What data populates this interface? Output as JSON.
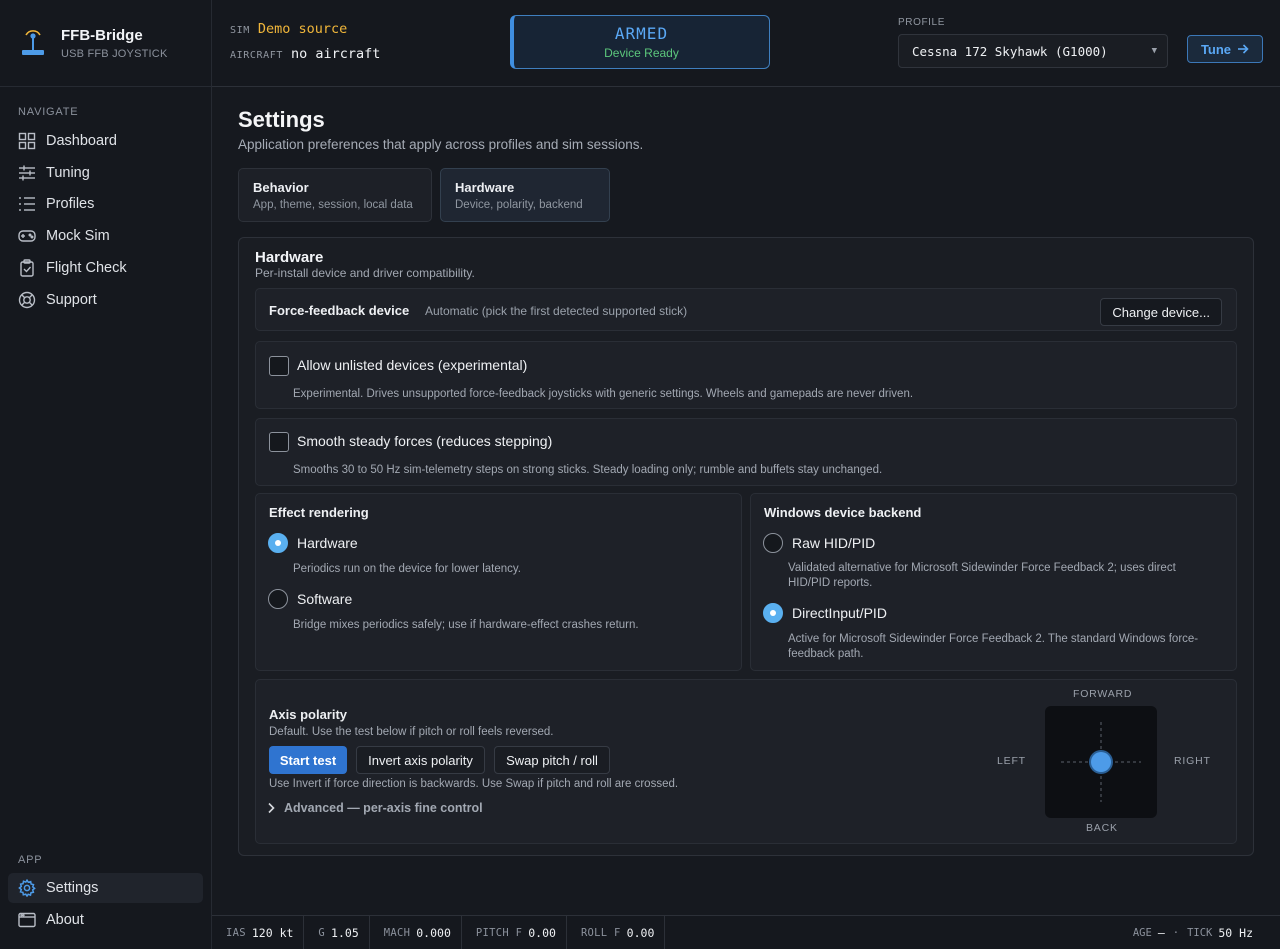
{
  "brand": {
    "name": "FFB-Bridge",
    "subtitle": "USB FFB JOYSTICK"
  },
  "sidebar": {
    "nav_heading": "NAVIGATE",
    "nav_items": [
      {
        "label": "Dashboard",
        "icon": "dashboard-icon"
      },
      {
        "label": "Tuning",
        "icon": "sliders-icon"
      },
      {
        "label": "Profiles",
        "icon": "list-icon"
      },
      {
        "label": "Mock Sim",
        "icon": "gamepad-icon"
      },
      {
        "label": "Flight Check",
        "icon": "clipboard-check-icon"
      },
      {
        "label": "Support",
        "icon": "lifebuoy-icon"
      }
    ],
    "app_heading": "APP",
    "app_items": [
      {
        "label": "Settings",
        "icon": "gear-icon",
        "active": true
      },
      {
        "label": "About",
        "icon": "window-icon",
        "active": false
      }
    ]
  },
  "topbar": {
    "sim_label": "SIM",
    "sim_value": "Demo source",
    "aircraft_label": "AIRCRAFT",
    "aircraft_value": "no aircraft",
    "status_title": "ARMED",
    "status_sub": "Device Ready",
    "profile_label": "PROFILE",
    "profile_value": "Cessna 172 Skyhawk (G1000)",
    "tune_label": "Tune"
  },
  "main": {
    "title": "Settings",
    "subtitle": "Application preferences that apply across profiles and sim sessions.",
    "tabs": [
      {
        "title": "Behavior",
        "desc": "App, theme, session, local data",
        "active": false
      },
      {
        "title": "Hardware",
        "desc": "Device, polarity, backend",
        "active": true
      }
    ],
    "hardware": {
      "title": "Hardware",
      "subtitle": "Per-install device and driver compatibility.",
      "device_label": "Force-feedback device",
      "device_value": "Automatic (pick the first detected supported stick)",
      "change_device": "Change device...",
      "allow_unlisted_label": "Allow unlisted devices (experimental)",
      "allow_unlisted_desc": "Experimental. Drives unsupported force-feedback joysticks with generic settings. Wheels and gamepads are never driven.",
      "allow_unlisted_checked": false,
      "smooth_label": "Smooth steady forces (reduces stepping)",
      "smooth_desc": "Smooths 30 to 50 Hz sim-telemetry steps on strong sticks. Steady loading only; rumble and buffets stay unchanged.",
      "smooth_checked": false,
      "effect_rendering": {
        "title": "Effect rendering",
        "options": [
          {
            "label": "Hardware",
            "desc": "Periodics run on the device for lower latency.",
            "selected": true
          },
          {
            "label": "Software",
            "desc": "Bridge mixes periodics safely; use if hardware-effect crashes return.",
            "selected": false
          }
        ]
      },
      "backend": {
        "title": "Windows device backend",
        "options": [
          {
            "label": "Raw HID/PID",
            "desc": "Validated alternative for Microsoft Sidewinder Force Feedback 2; uses direct HID/PID reports.",
            "selected": false
          },
          {
            "label": "DirectInput/PID",
            "desc": "Active for Microsoft Sidewinder Force Feedback 2. The standard Windows force-feedback path.",
            "selected": true
          }
        ]
      },
      "axis": {
        "title": "Axis polarity",
        "subtitle": "Default. Use the test below if pitch or roll feels reversed.",
        "start_test": "Start test",
        "invert": "Invert axis polarity",
        "swap": "Swap pitch / roll",
        "hint": "Use Invert if force direction is backwards. Use Swap if pitch and roll are crossed.",
        "advanced": "Advanced — per-axis fine control",
        "forward": "FORWARD",
        "back": "BACK",
        "left": "LEFT",
        "right": "RIGHT"
      }
    }
  },
  "statusbar": {
    "items": [
      {
        "k": "IAS",
        "v": "120 kt"
      },
      {
        "k": "G",
        "v": "1.05"
      },
      {
        "k": "MACH",
        "v": "0.000"
      },
      {
        "k": "PITCH F",
        "v": "0.00"
      },
      {
        "k": "ROLL F",
        "v": "0.00"
      }
    ],
    "age_label": "AGE",
    "age_value": "—",
    "sep": "·",
    "tick_label": "TICK",
    "tick_value": "50 Hz"
  },
  "colors": {
    "accent": "#4d9be8",
    "armed": "#5aa8f5",
    "ready": "#5cc77c",
    "sim": "#f0b63a",
    "primary_button": "#2f74d0"
  }
}
